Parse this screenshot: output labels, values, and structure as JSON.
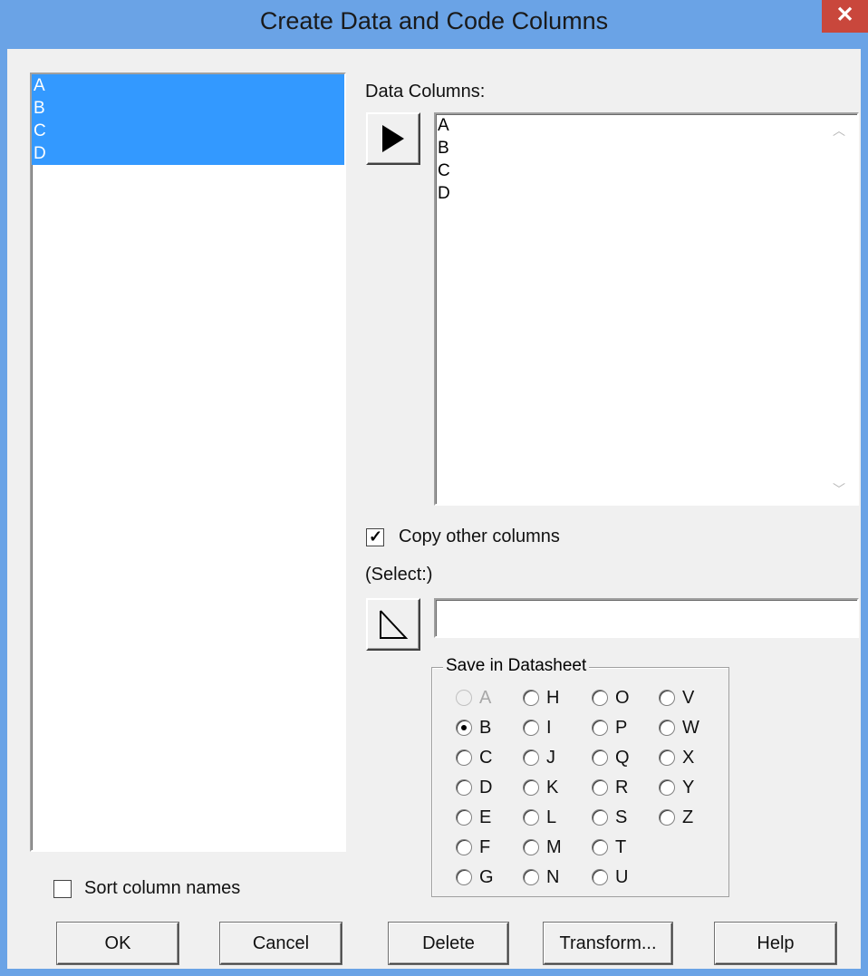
{
  "window": {
    "title": "Create Data and Code Columns",
    "close_glyph": "✕"
  },
  "source_list": {
    "items": [
      "A",
      "B",
      "C",
      "D"
    ]
  },
  "data_columns": {
    "label": "Data Columns:",
    "items": [
      "A",
      "B",
      "C",
      "D"
    ]
  },
  "copy_other": {
    "label": "Copy other columns",
    "checked": true
  },
  "select": {
    "label": "(Select:)",
    "value": ""
  },
  "save_in": {
    "label": "Save in Datasheet",
    "columns": [
      [
        "A",
        "B",
        "C",
        "D",
        "E",
        "F",
        "G"
      ],
      [
        "H",
        "I",
        "J",
        "K",
        "L",
        "M",
        "N"
      ],
      [
        "O",
        "P",
        "Q",
        "R",
        "S",
        "T",
        "U"
      ],
      [
        "V",
        "W",
        "X",
        "Y",
        "Z"
      ]
    ],
    "selected": "B",
    "disabled": [
      "A"
    ]
  },
  "sort": {
    "label": "Sort column names",
    "checked": false
  },
  "buttons": {
    "ok": "OK",
    "cancel": "Cancel",
    "delete": "Delete",
    "transform": "Transform...",
    "help": "Help"
  }
}
